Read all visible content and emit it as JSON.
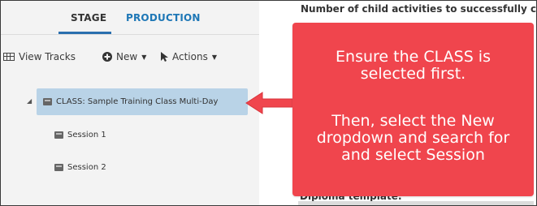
{
  "tabs": {
    "stage": "STAGE",
    "production": "PRODUCTION"
  },
  "toolbar": {
    "view_tracks": "View Tracks",
    "new": "New",
    "actions": "Actions"
  },
  "tree": {
    "selected_item": "CLASS: Sample Training Class Multi-Day",
    "children": [
      "Session 1",
      "Session 2"
    ]
  },
  "right_panel": {
    "title": "Number of child activities to successfully co",
    "diploma_label": "Diploma template:"
  },
  "callout": {
    "line1": "Ensure the CLASS is selected first.",
    "line2": "Then, select the New dropdown and search for and select Session",
    "color": "#f0454d"
  },
  "colors": {
    "accent": "#1e77b6",
    "selection": "#b9d3e7"
  }
}
